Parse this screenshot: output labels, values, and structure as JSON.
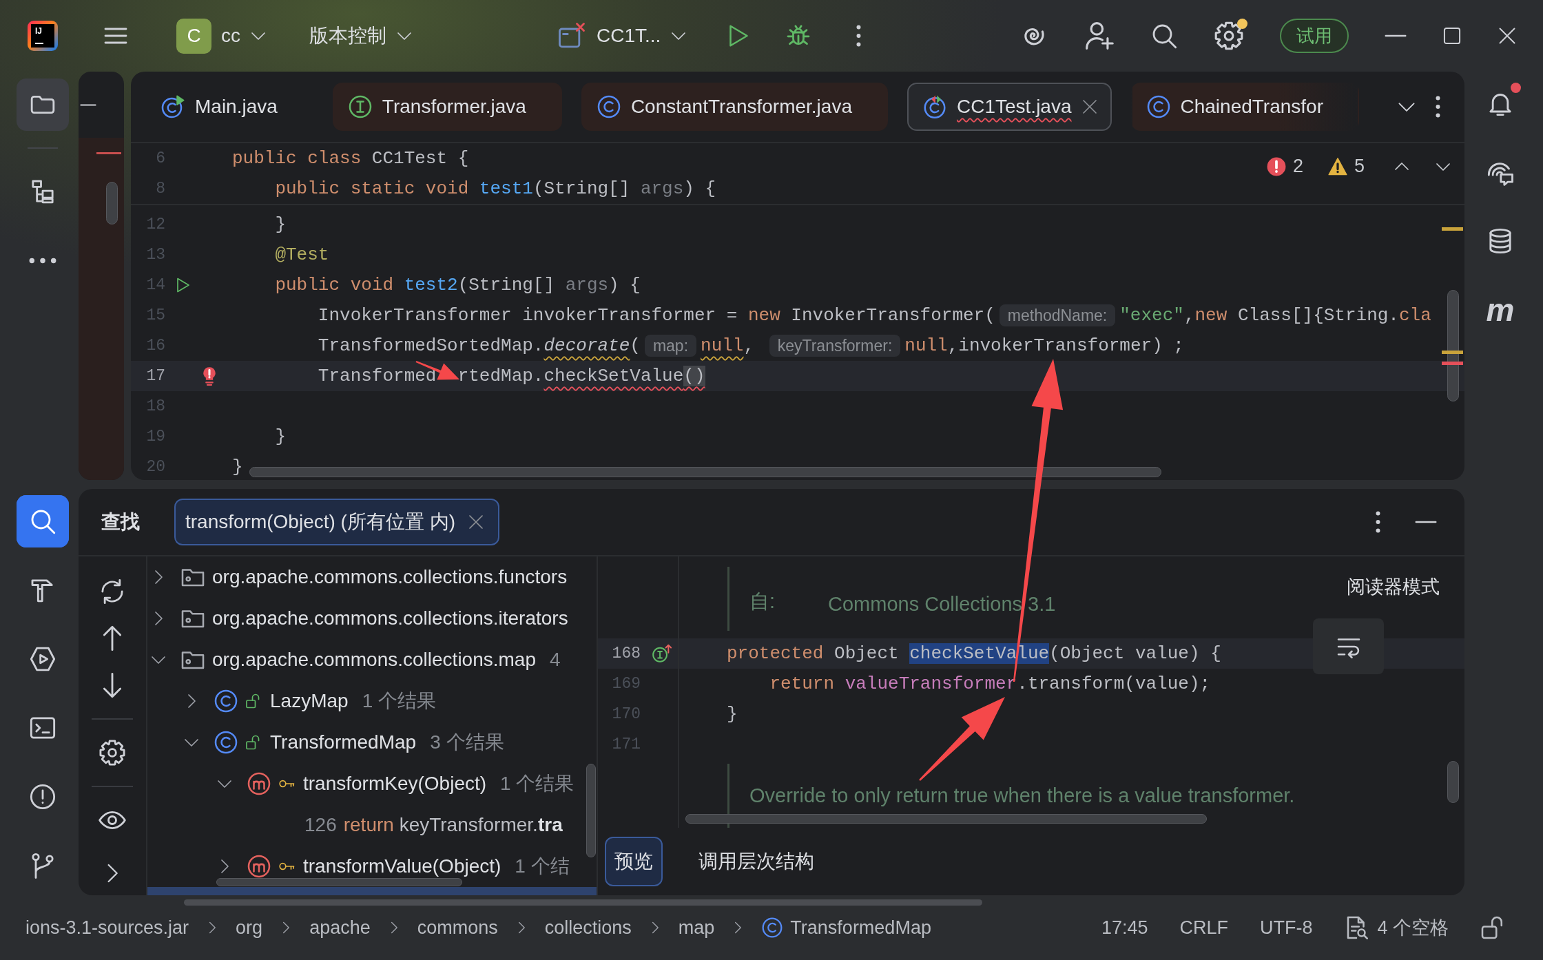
{
  "title_bar": {
    "logo_text": "IJ",
    "project": {
      "letter": "C",
      "name": "cc"
    },
    "vcs_menu": "版本控制",
    "run_config": "CC1T...",
    "settings_badge": true,
    "trial_button": "试用"
  },
  "left_toolbar": {
    "top": [
      {
        "kind": "project",
        "selected": true,
        "focused": false
      },
      {
        "kind": "structure",
        "selected": false,
        "focused": false
      },
      {
        "kind": "more",
        "selected": false,
        "focused": false
      }
    ],
    "bottom": [
      {
        "kind": "find",
        "selected": true,
        "focused": true
      },
      {
        "kind": "build",
        "selected": false,
        "focused": false
      },
      {
        "kind": "services",
        "selected": false,
        "focused": false
      },
      {
        "kind": "terminal",
        "selected": false,
        "focused": false
      },
      {
        "kind": "problems",
        "selected": false,
        "focused": false
      },
      {
        "kind": "git",
        "selected": false,
        "focused": false
      }
    ]
  },
  "editor": {
    "tabs": [
      {
        "label": "Main.java",
        "kind": "main-class",
        "tinted": false,
        "error": false,
        "selected": false
      },
      {
        "label": "Transformer.java",
        "kind": "interface",
        "tinted": true,
        "error": false,
        "selected": false
      },
      {
        "label": "ConstantTransformer.java",
        "kind": "class",
        "tinted": true,
        "error": false,
        "selected": false
      },
      {
        "label": "CC1Test.java",
        "kind": "test-class",
        "tinted": false,
        "error": true,
        "selected": true
      },
      {
        "label": "ChainedTransfor",
        "kind": "class",
        "tinted": true,
        "error": false,
        "selected": false
      }
    ],
    "problems": {
      "errors": "2",
      "warnings": "5"
    },
    "sticky_lines": [
      {
        "number": "6",
        "tokens": [
          {
            "kind": "keyword",
            "text": "public class "
          },
          {
            "kind": "plain",
            "text": "CC1Test {"
          }
        ]
      },
      {
        "number": "8",
        "tokens": [
          {
            "kind": "keyword",
            "text": "    public static void "
          },
          {
            "kind": "method",
            "text": "test1"
          },
          {
            "kind": "plain",
            "text": "(String[] "
          },
          {
            "kind": "param",
            "text": "args"
          },
          {
            "kind": "plain",
            "text": ") {"
          }
        ]
      }
    ],
    "lines": [
      {
        "number": "12",
        "kind": "code",
        "current": false,
        "tokens": [
          {
            "kind": "plain",
            "text": "    }"
          }
        ]
      },
      {
        "number": "13",
        "kind": "code",
        "current": false,
        "tokens": [
          {
            "kind": "annotation",
            "text": "    @Test"
          }
        ]
      },
      {
        "number": "14",
        "kind": "run",
        "current": false,
        "tokens": [
          {
            "kind": "keyword",
            "text": "    public void "
          },
          {
            "kind": "method",
            "text": "test2"
          },
          {
            "kind": "plain",
            "text": "(String[] "
          },
          {
            "kind": "param",
            "text": "args"
          },
          {
            "kind": "plain",
            "text": ") {"
          }
        ]
      },
      {
        "number": "15",
        "kind": "code",
        "current": false,
        "tokens": [
          {
            "kind": "plain",
            "text": "        InvokerTransformer invokerTransformer = "
          },
          {
            "kind": "keyword",
            "text": "new "
          },
          {
            "kind": "plain",
            "text": "InvokerTransformer("
          },
          {
            "kind": "hint",
            "text": "methodName:"
          },
          {
            "kind": "string",
            "text": "\"exec\""
          },
          {
            "kind": "plain",
            "text": ","
          },
          {
            "kind": "keyword",
            "text": "new "
          },
          {
            "kind": "plain",
            "text": "Class[]{String."
          },
          {
            "kind": "keyword",
            "text": "cla"
          }
        ]
      },
      {
        "number": "16",
        "kind": "code",
        "current": false,
        "tokens": [
          {
            "kind": "plain",
            "text": "        TransformedSortedMap."
          },
          {
            "kind": "static-call-warning",
            "text": "decorate"
          },
          {
            "kind": "plain",
            "text": "("
          },
          {
            "kind": "hint",
            "text": "map:"
          },
          {
            "kind": "keyword-warning",
            "text": "null"
          },
          {
            "kind": "plain",
            "text": ", "
          },
          {
            "kind": "hint",
            "text": "keyTransformer:"
          },
          {
            "kind": "keyword",
            "text": "null"
          },
          {
            "kind": "plain",
            "text": ",invokerTransformer) ;"
          }
        ]
      },
      {
        "number": "17",
        "kind": "error-bulb",
        "current": true,
        "tokens": [
          {
            "kind": "plain",
            "text": "        Transformed"
          },
          {
            "kind": "covered"
          },
          {
            "kind": "plain",
            "text": "rtedMap."
          },
          {
            "kind": "call-error",
            "text": "checkSetValue"
          },
          {
            "kind": "brace-error",
            "text": "()"
          }
        ]
      },
      {
        "number": "18",
        "kind": "code",
        "current": false
      },
      {
        "number": "19",
        "kind": "code",
        "current": false,
        "tokens": [
          {
            "kind": "plain",
            "text": "    }"
          }
        ]
      },
      {
        "number": "20",
        "kind": "code",
        "current": false,
        "tokens": [
          {
            "kind": "plain",
            "text": "}"
          }
        ]
      }
    ],
    "stripe_marks": [
      {
        "kind": "warning"
      },
      {
        "kind": "warning"
      },
      {
        "kind": "error"
      }
    ]
  },
  "right_toolbar": [
    {
      "kind": "notifications",
      "badge": true
    },
    {
      "kind": "ai-chat",
      "badge": false
    },
    {
      "kind": "database",
      "badge": false
    },
    {
      "kind": "maven",
      "glyph": "m",
      "badge": false
    }
  ],
  "find_panel": {
    "title": "查找",
    "tab": {
      "label": "transform(Object) (所有位置 内)",
      "selected": true
    },
    "tree": [
      {
        "kind": "package",
        "label": "org.apache.commons.collections.functors",
        "expanded": false,
        "selected": false
      },
      {
        "kind": "package",
        "label": "org.apache.commons.collections.iterators",
        "expanded": false,
        "selected": false
      },
      {
        "kind": "package",
        "label": "org.apache.commons.collections.map",
        "count": "4",
        "expanded": true,
        "selected": false,
        "children": [
          {
            "kind": "class",
            "protected": false,
            "label": "LazyMap",
            "count": "1 个结果",
            "expanded": false,
            "selected": false
          },
          {
            "kind": "class",
            "protected": false,
            "label": "TransformedMap",
            "count": "3 个结果",
            "expanded": true,
            "selected": false,
            "children": [
              {
                "kind": "method",
                "protected": true,
                "label": "transformKey(Object)",
                "count": "1 个结果",
                "expanded": true,
                "selected": false,
                "children": [
                  {
                    "kind": "usage",
                    "line": "126",
                    "code": [
                      {
                        "kind": "keyword",
                        "text": "return "
                      },
                      {
                        "kind": "plain",
                        "text": "keyTransformer."
                      },
                      {
                        "kind": "match",
                        "text": "tra"
                      }
                    ]
                  }
                ]
              },
              {
                "kind": "method",
                "protected": true,
                "label": "transformValue(Object)",
                "count": "1 个结",
                "expanded": false,
                "selected": false
              },
              {
                "kind": "method",
                "selected": true
              }
            ]
          }
        ]
      }
    ],
    "preview": {
      "doc_above": {
        "label": "自:",
        "value": "Commons Collections 3.1"
      },
      "lines": [
        {
          "number": "168",
          "kind": "override",
          "current": true,
          "tokens": [
            {
              "kind": "keyword",
              "text": "protected "
            },
            {
              "kind": "plain",
              "text": "Object "
            },
            {
              "kind": "selection",
              "text": "checkSetValue"
            },
            {
              "kind": "plain",
              "text": "(Object value) {"
            }
          ]
        },
        {
          "number": "169",
          "kind": "code",
          "current": false,
          "tokens": [
            {
              "kind": "keyword",
              "text": "    return "
            },
            {
              "kind": "field",
              "text": "valueTransformer"
            },
            {
              "kind": "plain",
              "text": ".transform(value);"
            }
          ]
        },
        {
          "number": "170",
          "kind": "code",
          "current": false,
          "tokens": [
            {
              "kind": "plain",
              "text": "}"
            }
          ]
        },
        {
          "number": "171",
          "kind": "code",
          "current": false
        }
      ],
      "doc_below": "Override to only return true when there is a value transformer.",
      "reader_mode": "阅读器模式"
    },
    "bottom_tabs": [
      {
        "label": "预览",
        "selected": true
      },
      {
        "label": "调用层次结构",
        "selected": false
      }
    ]
  },
  "status_bar": {
    "breadcrumbs": [
      {
        "kind": "plain",
        "label": "ions-3.1-sources.jar"
      },
      {
        "kind": "plain",
        "label": "org"
      },
      {
        "kind": "plain",
        "label": "apache"
      },
      {
        "kind": "plain",
        "label": "commons"
      },
      {
        "kind": "plain",
        "label": "collections"
      },
      {
        "kind": "plain",
        "label": "map"
      },
      {
        "kind": "class",
        "label": "TransformedMap"
      }
    ],
    "caret_position": "17:45",
    "line_separator": "CRLF",
    "encoding": "UTF-8",
    "indent": "4 个空格",
    "read_only": false
  }
}
